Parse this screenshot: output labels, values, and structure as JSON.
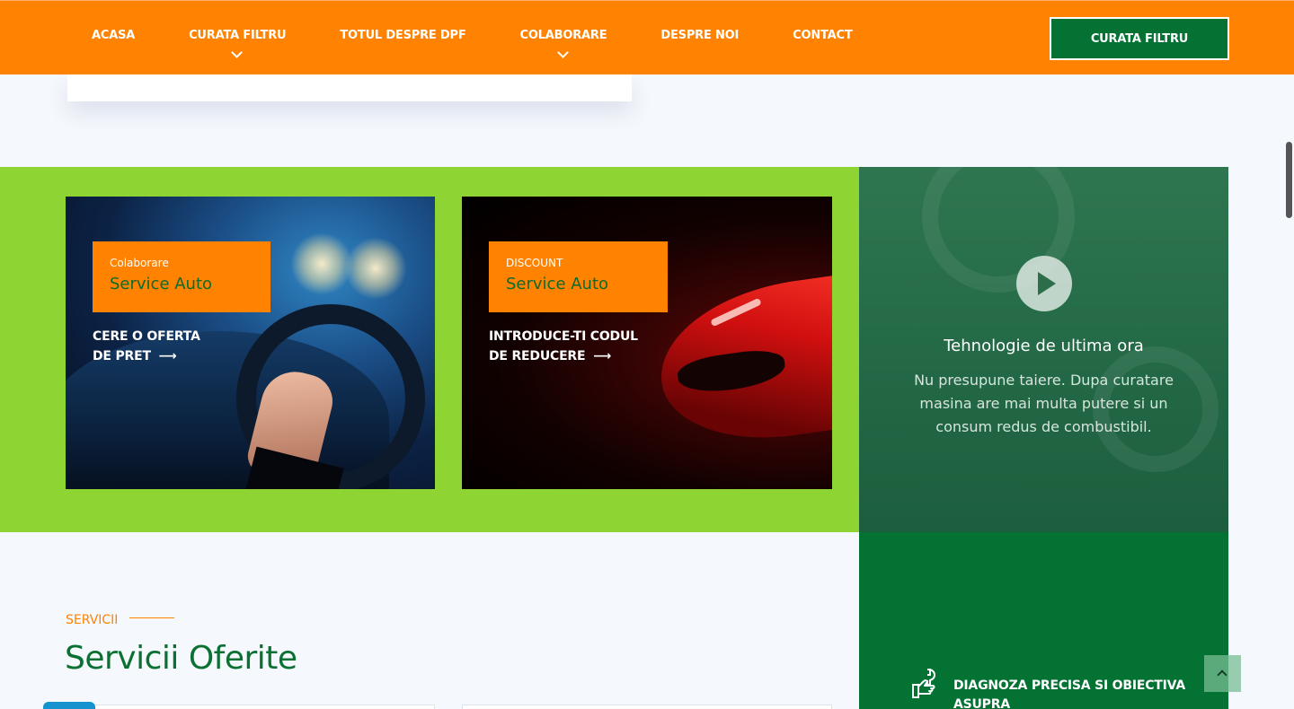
{
  "header": {
    "nav": [
      {
        "label": "ACASA",
        "dropdown": false
      },
      {
        "label": "CURATA FILTRU",
        "dropdown": true
      },
      {
        "label": "TOTUL DESPRE DPF",
        "dropdown": false
      },
      {
        "label": "COLABORARE",
        "dropdown": true
      },
      {
        "label": "DESPRE NOI",
        "dropdown": false
      },
      {
        "label": "CONTACT",
        "dropdown": false
      }
    ],
    "cta_label": "CURATA FILTRU"
  },
  "promos": [
    {
      "small": "Colaborare",
      "big": "Service Auto",
      "link_line1": "CERE O OFERTA",
      "link_line2": "DE PRET",
      "arrow": "⟶"
    },
    {
      "small": "DISCOUNT",
      "big": "Service Auto",
      "link_line1": "INTRODUCE-TI CODUL",
      "link_line2": "DE REDUCERE",
      "arrow": "⟶"
    }
  ],
  "video": {
    "title": "Tehnologie de ultima ora",
    "text": "Nu presupune taiere. Dupa curatare masina are mai multa putere si un consum redus de combustibil.",
    "icon": "play-icon"
  },
  "feature": {
    "icon": "wrench-hand-icon",
    "text": "DIAGNOZA PRECISA SI OBIECTIVA ASUPRA"
  },
  "services": {
    "kicker": "SERVICII",
    "title": "Servicii Oferite"
  },
  "colors": {
    "orange": "#ff8200",
    "green_light": "#8ed433",
    "green_dark": "#047233"
  }
}
